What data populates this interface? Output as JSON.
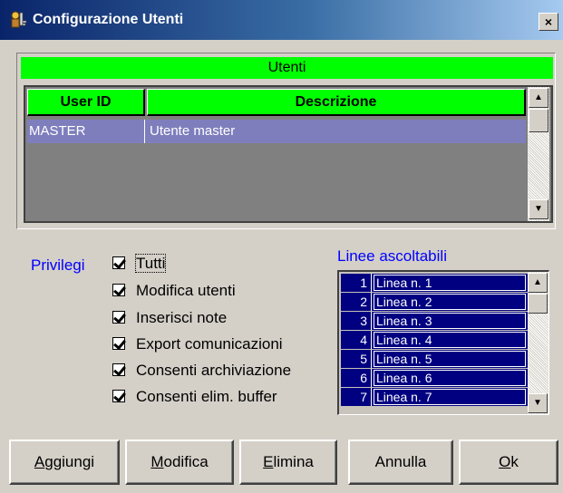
{
  "window": {
    "title": "Configurazione Utenti",
    "close_glyph": "×",
    "icon": "keys-user-icon"
  },
  "users": {
    "header": "Utenti",
    "columns": [
      "User ID",
      "Descrizione"
    ],
    "rows": [
      {
        "user_id": "MASTER",
        "description": "Utente master"
      }
    ]
  },
  "privileges": {
    "label": "Privilegi",
    "items": [
      {
        "label": "Tutti",
        "checked": true
      },
      {
        "label": "Modifica utenti",
        "checked": true
      },
      {
        "label": "Inserisci note",
        "checked": true
      },
      {
        "label": "Export comunicazioni",
        "checked": true
      },
      {
        "label": "Consenti archiviazione",
        "checked": true
      },
      {
        "label": "Consenti elim. buffer",
        "checked": true
      }
    ]
  },
  "lines": {
    "label": "Linee ascoltabili",
    "items": [
      {
        "num": "1",
        "name": "Linea n. 1"
      },
      {
        "num": "2",
        "name": "Linea n. 2"
      },
      {
        "num": "3",
        "name": "Linea n. 3"
      },
      {
        "num": "4",
        "name": "Linea n. 4"
      },
      {
        "num": "5",
        "name": "Linea n. 5"
      },
      {
        "num": "6",
        "name": "Linea n. 6"
      },
      {
        "num": "7",
        "name": "Linea n. 7"
      }
    ]
  },
  "buttons": {
    "add": {
      "first": "A",
      "rest": "ggiungi"
    },
    "modify": {
      "first": "M",
      "rest": "odifica"
    },
    "delete": {
      "first": "E",
      "rest": "limina"
    },
    "cancel": "Annulla",
    "ok": {
      "first": "O",
      "rest": "k"
    }
  },
  "colors": {
    "header_green": "#00ff00",
    "selection_purple": "#7e7ebd",
    "list_navy": "#000080",
    "label_blue": "#0000ff"
  }
}
